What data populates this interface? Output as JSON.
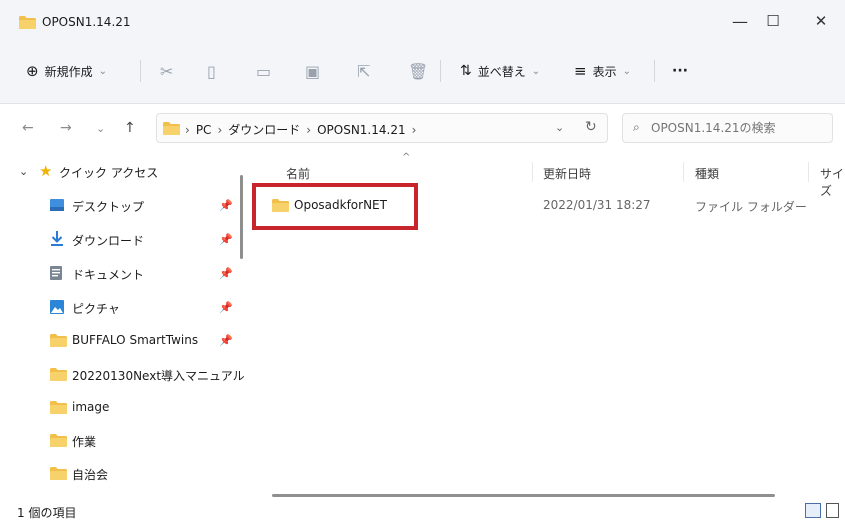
{
  "window": {
    "title": "OPOSN1.14.21",
    "minimize": "—",
    "maximize": "☐",
    "close": "✕"
  },
  "toolbar": {
    "new_label": "新規作成",
    "new_icon": "⊕",
    "new_chevron": "⌄",
    "sort_label": "並べ替え",
    "sort_icon": "⇅",
    "sort_chevron": "⌄",
    "view_label": "表示",
    "view_icon": "≡",
    "view_chevron": "⌄",
    "more_label": "···"
  },
  "address": {
    "back": "←",
    "forward": "→",
    "recent": "⌄",
    "up": "↑",
    "crumbs": [
      "PC",
      "ダウンロード",
      "OPOSN1.14.21"
    ],
    "sep": "›",
    "dropdown": "⌄",
    "refresh": "↻"
  },
  "search": {
    "placeholder": "OPOSN1.14.21の検索",
    "icon": "⌕"
  },
  "sidebar": {
    "quick_access": "クイック アクセス",
    "expand": "⌄",
    "items": [
      {
        "label": "デスクトップ",
        "pinned": true
      },
      {
        "label": "ダウンロード",
        "pinned": true
      },
      {
        "label": "ドキュメント",
        "pinned": true
      },
      {
        "label": "ピクチャ",
        "pinned": true
      },
      {
        "label": "BUFFALO SmartTwins",
        "pinned": true
      },
      {
        "label": "20220130Next導入マニュアル",
        "pinned": false
      },
      {
        "label": "image",
        "pinned": false
      },
      {
        "label": "作業",
        "pinned": false
      },
      {
        "label": "自治会",
        "pinned": false
      }
    ]
  },
  "columns": {
    "name": "名前",
    "modified": "更新日時",
    "type": "種類",
    "size": "サイズ",
    "sort_indicator": "^"
  },
  "files": [
    {
      "name": "OposadkforNET",
      "modified": "2022/01/31 18:27",
      "type": "ファイル フォルダー"
    }
  ],
  "status": {
    "count": "1 個の項目"
  },
  "colors": {
    "folder": "#f2c04a",
    "highlight": "#c7252b",
    "star": "#f0b400",
    "download": "#2b7bd6"
  }
}
